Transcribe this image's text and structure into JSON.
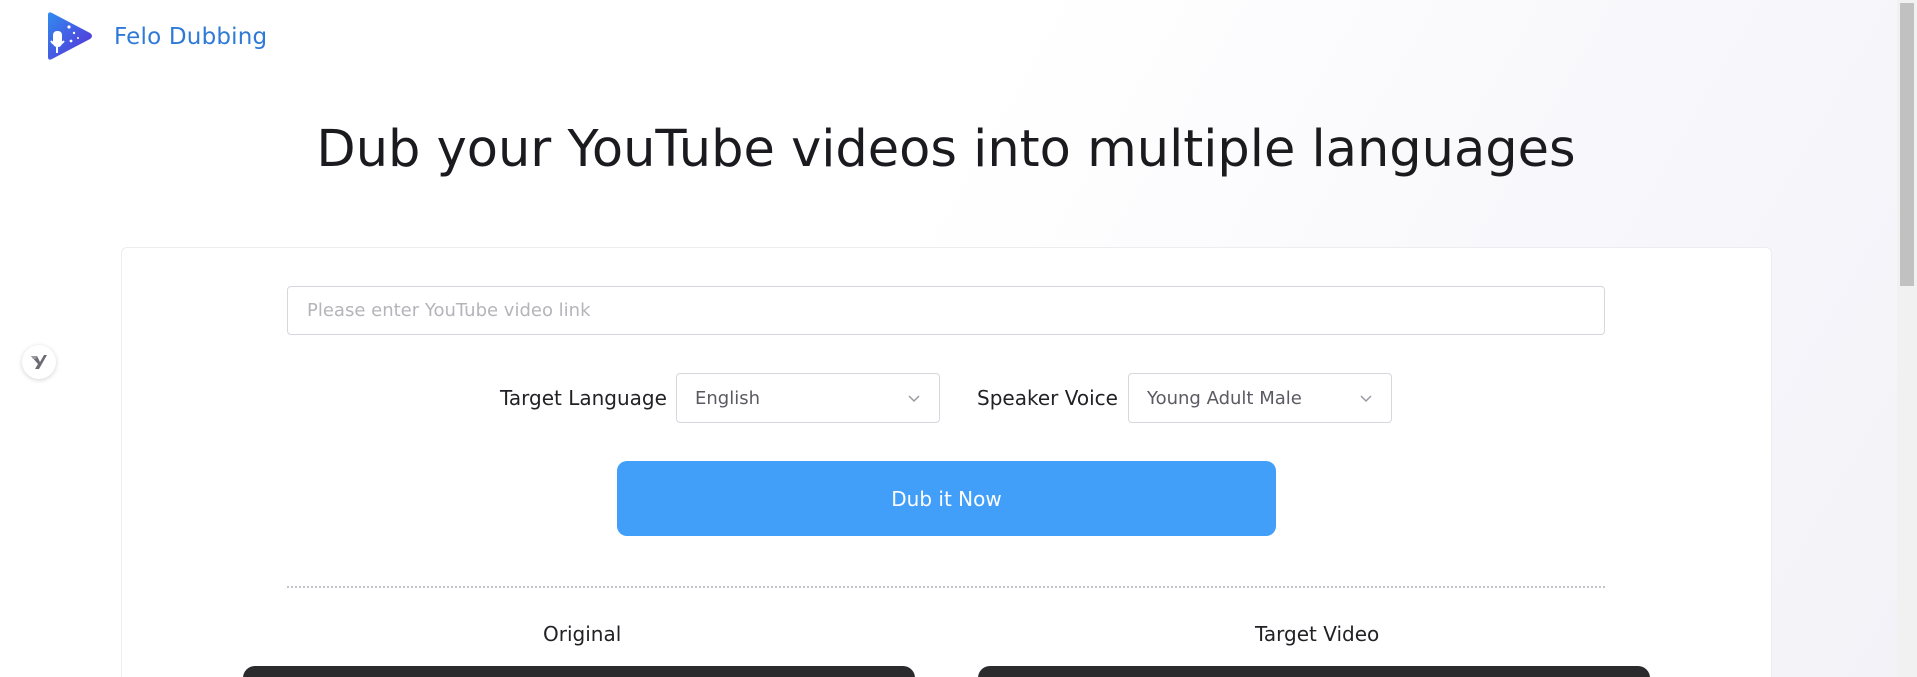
{
  "brand": {
    "name": "Felo Dubbing",
    "icon": "felo-play-mic-logo-icon",
    "color": "#2f7ad6"
  },
  "hero": {
    "title": "Dub your YouTube videos into multiple languages"
  },
  "form": {
    "url_input": {
      "value": "",
      "placeholder": "Please enter YouTube video link"
    },
    "target_language": {
      "label": "Target Language",
      "selected": "English"
    },
    "speaker_voice": {
      "label": "Speaker Voice",
      "selected": "Young Adult Male"
    },
    "submit_label": "Dub it Now",
    "accent_color": "#419ffa"
  },
  "preview": {
    "original_title": "Original",
    "target_title": "Target Video"
  },
  "side_badge": {
    "icon": "felo-y-badge-icon"
  }
}
